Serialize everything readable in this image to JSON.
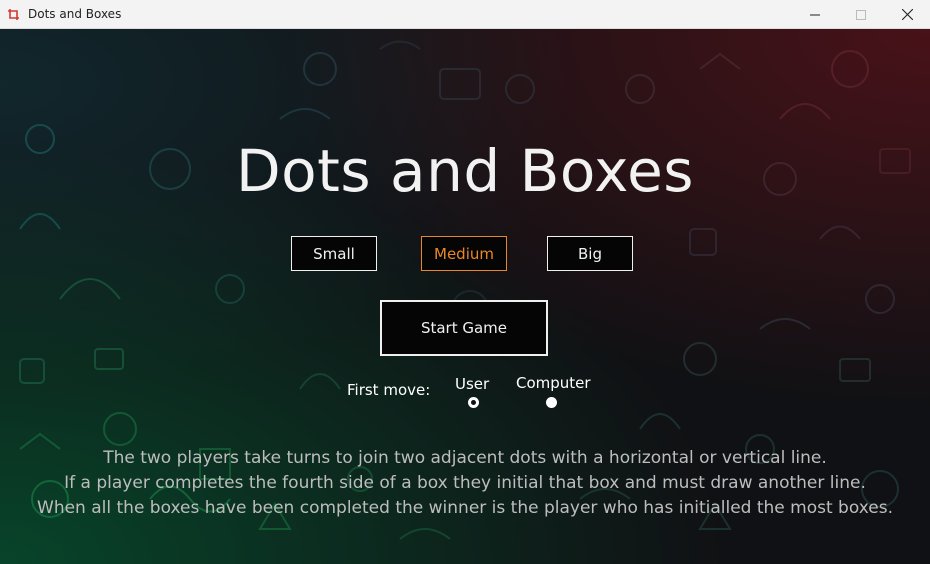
{
  "window": {
    "title": "Dots and Boxes",
    "accent": "#e8872a"
  },
  "game": {
    "title": "Dots and Boxes"
  },
  "board_size": {
    "options": [
      "Small",
      "Medium",
      "Big"
    ],
    "selected": "Medium"
  },
  "start_button": {
    "label": "Start Game"
  },
  "first_move": {
    "label": "First move:",
    "options": [
      "User",
      "Computer"
    ],
    "selected": "User"
  },
  "rules": [
    "The two players take turns to join two adjacent dots with a horizontal or vertical line.",
    "If a player completes the fourth side of a box they initial that box and must draw another line.",
    "When all the boxes have been completed the winner is the player who has initialled the most boxes."
  ]
}
